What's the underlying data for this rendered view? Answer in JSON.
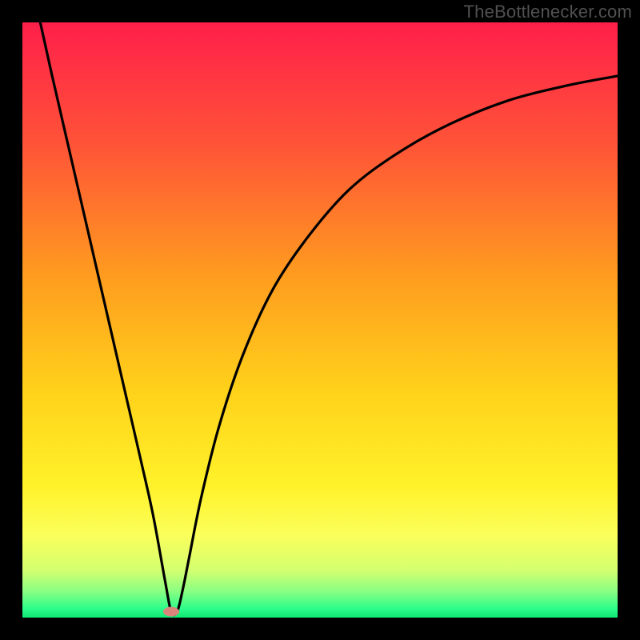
{
  "attribution": "TheBottlenecker.com",
  "chart_data": {
    "type": "line",
    "title": "",
    "xlabel": "",
    "ylabel": "",
    "xlim": [
      0,
      100
    ],
    "ylim": [
      0,
      100
    ],
    "minimum_x": 25,
    "series": [
      {
        "name": "bottleneck-curve",
        "x": [
          3,
          5,
          8,
          11,
          14,
          17,
          20,
          22,
          24,
          25,
          26,
          27,
          28,
          30,
          33,
          37,
          42,
          48,
          55,
          63,
          72,
          82,
          92,
          100
        ],
        "y": [
          100,
          91,
          78,
          65,
          52,
          39,
          26,
          17,
          6,
          1,
          1,
          5,
          10,
          20,
          32,
          44,
          55,
          64,
          72,
          78,
          83,
          87,
          89.5,
          91
        ]
      }
    ],
    "marker": {
      "x": 25,
      "y": 1,
      "color": "#d9857b"
    },
    "background_gradient_stops": [
      {
        "offset": 0,
        "color": "#ff1f4a"
      },
      {
        "offset": 0.2,
        "color": "#ff5238"
      },
      {
        "offset": 0.42,
        "color": "#ff9a1f"
      },
      {
        "offset": 0.62,
        "color": "#ffd21a"
      },
      {
        "offset": 0.78,
        "color": "#fff22a"
      },
      {
        "offset": 0.86,
        "color": "#fbff5a"
      },
      {
        "offset": 0.92,
        "color": "#d4ff70"
      },
      {
        "offset": 0.955,
        "color": "#8cff82"
      },
      {
        "offset": 0.985,
        "color": "#2dfd8a"
      },
      {
        "offset": 1.0,
        "color": "#0fe874"
      }
    ]
  }
}
